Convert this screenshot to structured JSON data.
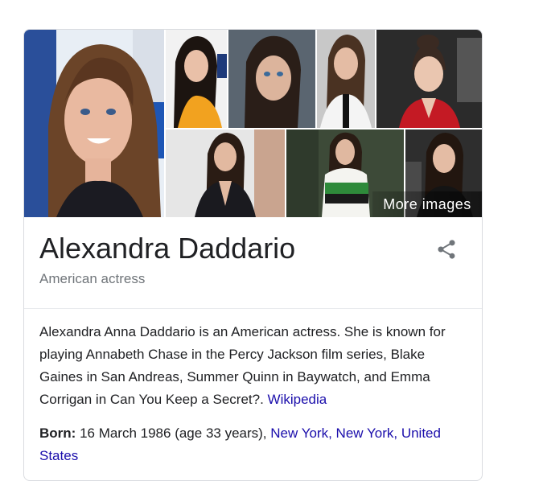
{
  "knowledge_panel": {
    "more_images_label": "More images",
    "name": "Alexandra Daddario",
    "subtitle": "American actress",
    "description": "Alexandra Anna Daddario is an American actress. She is known for playing Annabeth Chase in the Percy Jackson film series, Blake Gaines in San Andreas, Summer Quinn in Baywatch, and Emma Corrigan in Can You Keep a Secret?.",
    "source_link": "Wikipedia",
    "born": {
      "label": "Born:",
      "text": "16 March 1986 (age 33 years),",
      "place_links": [
        "New York,",
        "New York,",
        "United States"
      ]
    },
    "colors": {
      "link": "#1a0dab",
      "secondary_text": "#70757a",
      "border": "#dadce0"
    },
    "icons": [
      "share-icon"
    ]
  }
}
